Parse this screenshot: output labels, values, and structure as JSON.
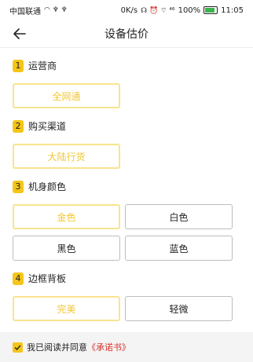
{
  "status_bar": {
    "carrier": "中国联通",
    "carrier_icons": "◠ ♆ ♆",
    "net_speed": "0K/s",
    "status_icons": "☊ ⏰ ⌔ ⁴⁶",
    "battery_percent": "100%",
    "time": "11:05"
  },
  "nav": {
    "title": "设备估价",
    "back_icon": "back-arrow-icon"
  },
  "sections": [
    {
      "num": "1",
      "label": "运营商",
      "options": [
        {
          "label": "全网通",
          "selected": true
        }
      ]
    },
    {
      "num": "2",
      "label": "购买渠道",
      "options": [
        {
          "label": "大陆行货",
          "selected": true
        }
      ]
    },
    {
      "num": "3",
      "label": "机身颜色",
      "options": [
        {
          "label": "金色",
          "selected": true
        },
        {
          "label": "白色",
          "selected": false
        },
        {
          "label": "黑色",
          "selected": false
        },
        {
          "label": "蓝色",
          "selected": false
        }
      ]
    },
    {
      "num": "4",
      "label": "边框背板",
      "options": [
        {
          "label": "完美",
          "selected": true
        },
        {
          "label": "轻微",
          "selected": false
        }
      ]
    }
  ],
  "footer": {
    "agree_text": "我已阅读并同意",
    "link_text": "《承诺书》",
    "checked": true
  },
  "colors": {
    "accent": "#f5c518",
    "selected_border": "#f8e48f",
    "selected_text": "#f2c731",
    "link": "#d9302c"
  }
}
